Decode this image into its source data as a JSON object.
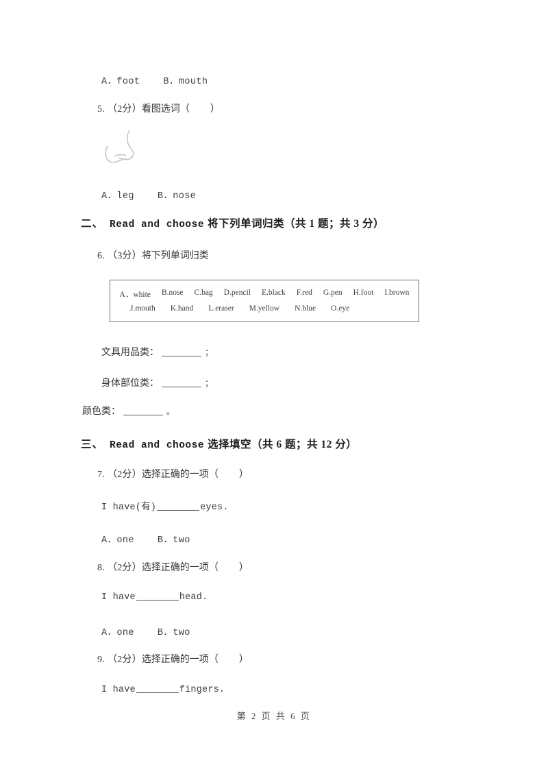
{
  "document": {
    "type": "exam-paper",
    "language": "zh-CN/en",
    "page_footer": "第 2 页 共 6 页"
  },
  "q4_options": {
    "option_a": "A．foot",
    "option_b": "B．mouth"
  },
  "q5": {
    "number": "5.",
    "score": "（2分）",
    "prompt": "看图选词（",
    "close_paren": "）",
    "image_name": "nose-line-drawing",
    "option_a": "A．leg",
    "option_b": "B．nose"
  },
  "section_two": {
    "index": "二、",
    "english": "Read and choose",
    "chinese": "将下列单词归类（共 1 题；共 3 分）"
  },
  "q6": {
    "number": "6.",
    "score": "（3分）",
    "prompt": "将下列单词归类",
    "word_bank": {
      "row1": [
        "A．white",
        "B.nose",
        "C.bag",
        "D.pencil",
        "E.black",
        "F.red",
        "G.pen",
        "H.foot",
        "I.brown"
      ],
      "row2": [
        "J.mouth",
        "K.hand",
        "L.eraser",
        "M.yellow",
        "N.blue",
        "O.eye"
      ]
    },
    "categories": [
      {
        "label": "文具用品类：",
        "end": "；"
      },
      {
        "label": "身体部位类：",
        "end": "；"
      },
      {
        "label": "颜色类：",
        "end": "。"
      }
    ]
  },
  "section_three": {
    "index": "三、",
    "english": "Read and choose",
    "chinese": "选择填空（共 6 题；共 12 分）"
  },
  "q7": {
    "number": "7.",
    "score": "（2分）",
    "prompt": "选择正确的一项（",
    "close_paren": "）",
    "sentence_pre": "I have(有)",
    "sentence_post": "eyes.",
    "option_a": "A．one",
    "option_b": "B．two"
  },
  "q8": {
    "number": "8.",
    "score": "（2分）",
    "prompt": "选择正确的一项（",
    "close_paren": "）",
    "sentence_pre": "I have",
    "sentence_post": "head.",
    "option_a": "A．one",
    "option_b": "B．two"
  },
  "q9": {
    "number": "9.",
    "score": "（2分）",
    "prompt": "选择正确的一项（",
    "close_paren": "）",
    "sentence_pre": "I have",
    "sentence_post": "fingers."
  },
  "colors": {
    "text": "#3a3a3a",
    "heading": "#1d1d1d",
    "box_border": "#6e6e6e",
    "drawing": "#c9c9c9",
    "page_background": "#ffffff"
  }
}
